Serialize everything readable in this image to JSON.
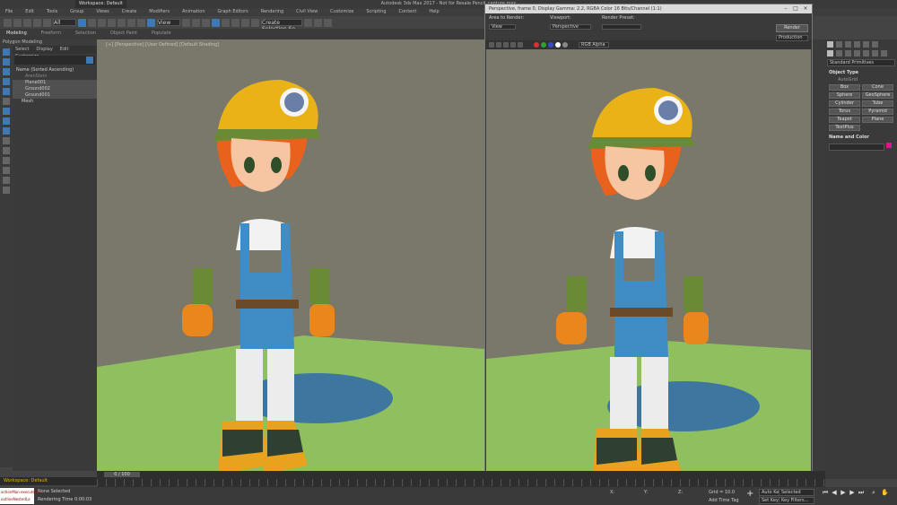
{
  "window": {
    "app_title": "Autodesk 3ds Max 2017 - Not for Resale    Pencil_capture.max",
    "workspace_tab": "Workspace: Default"
  },
  "menu": [
    "File",
    "Edit",
    "Tools",
    "Group",
    "Views",
    "Create",
    "Modifiers",
    "Animation",
    "Graph Editors",
    "Rendering",
    "Civil View",
    "Customize",
    "Scripting",
    "Content",
    "Help"
  ],
  "toolbar": {
    "selection_filter": "All",
    "ref_coord": "View",
    "named_selection": "Create Selection Se"
  },
  "ribbon": {
    "tabs": [
      "Modeling",
      "Freeform",
      "Selection",
      "Object Paint",
      "Populate"
    ],
    "active_tab": "Modeling",
    "sub_label": "Polygon Modeling"
  },
  "scene_explorer": {
    "tabs": [
      "Select",
      "Display",
      "Edit",
      "Customize"
    ],
    "header": "Name (Sorted Ascending)",
    "items": [
      "ArenStein",
      "Plane001",
      "Ground002",
      "Ground001",
      "Mesh"
    ]
  },
  "viewport": {
    "label": "[+] [Perspective] [User Defined] [Default Shading]"
  },
  "render_window": {
    "title": "Perspective, frame 0, Display Gamma: 2.2, RGBA Color 16 Bits/Channel (1:1)",
    "area_label": "Area to Render:",
    "area_value": "View",
    "viewport_label": "Viewport:",
    "viewport_value": "Perspective",
    "preset_label": "Render Preset:",
    "render_button": "Render",
    "production": "Production",
    "channel": "RGB Alpha",
    "swatches": [
      "#d93030",
      "#30a030",
      "#3050d0",
      "#ffffff",
      "#888888"
    ]
  },
  "command_panel": {
    "category": "Standard Primitives",
    "object_type_title": "Object Type",
    "autogrid": "AutoGrid",
    "buttons": [
      "Box",
      "Cone",
      "Sphere",
      "GeoSphere",
      "Cylinder",
      "Tube",
      "Torus",
      "Pyramid",
      "Teapot",
      "Plane",
      "TextPlus"
    ],
    "name_color_title": "Name and Color",
    "color": "#d21a8c"
  },
  "timeline": {
    "slider": "0 / 100"
  },
  "status": {
    "workspace": "Workspace: Default",
    "maxscript_line1": "actionMan.executeAct",
    "maxscript_line2": "outlineNestedLa",
    "selected": "None Selected",
    "rendering_time": "Rendering Time  0:00:03",
    "x_label": "X:",
    "y_label": "Y:",
    "z_label": "Z:",
    "grid": "Grid = 10.0",
    "add_time_tag": "Add Time Tag",
    "auto_key": "Auto Key",
    "set_key": "Set Key",
    "selected_dd": "Selected",
    "key_filters": "Key Filters..."
  }
}
